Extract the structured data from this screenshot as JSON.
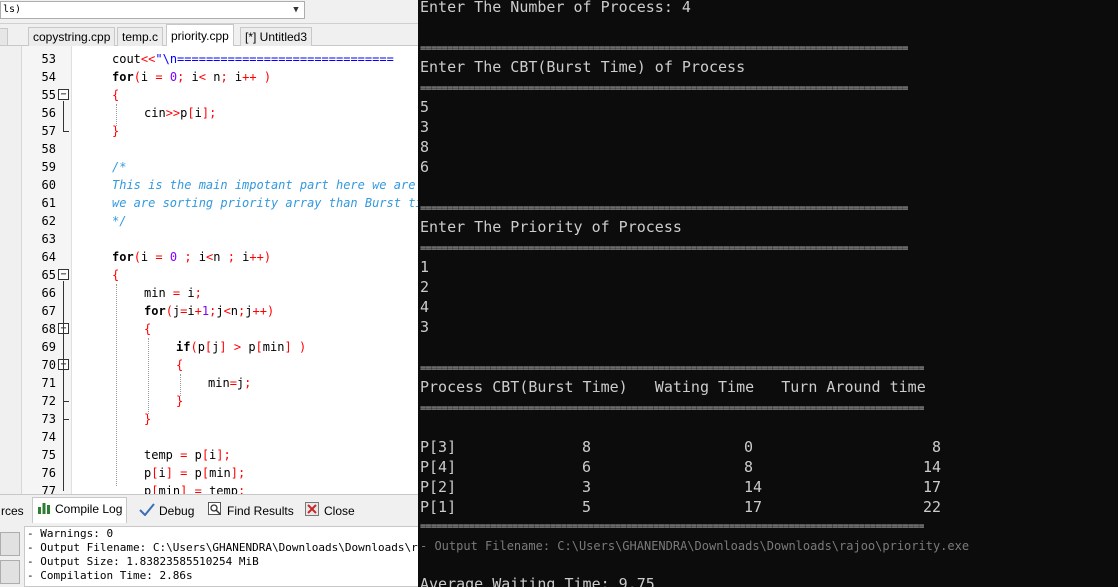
{
  "ide": {
    "scope_combo": "ls)",
    "tabs": [
      "copystring.cpp",
      "temp.c",
      "priority.cpp",
      "[*] Untitled3"
    ],
    "code_lines": [
      {
        "num": "53",
        "text": "cout<<\"\\n=============================="
      },
      {
        "num": "54",
        "text": "for(i = 0; i< n; i++ )"
      },
      {
        "num": "55",
        "text": "{"
      },
      {
        "num": "56",
        "text": "cin>>p[i];"
      },
      {
        "num": "57",
        "text": "}"
      },
      {
        "num": "58",
        "text": ""
      },
      {
        "num": "59",
        "text": "/*"
      },
      {
        "num": "60",
        "text": "This is the main impotant part here we are sorting on order according to priority given and if"
      },
      {
        "num": "61",
        "text": "we are sorting priority array than Burst time array will also sort"
      },
      {
        "num": "62",
        "text": "*/"
      },
      {
        "num": "63",
        "text": ""
      },
      {
        "num": "64",
        "text": "for(i = 0 ; i<n ; i++)"
      },
      {
        "num": "65",
        "text": "{"
      },
      {
        "num": "66",
        "text": "min = i;"
      },
      {
        "num": "67",
        "text": "for(j=i+1;j<n;j++)"
      },
      {
        "num": "68",
        "text": "{"
      },
      {
        "num": "69",
        "text": "if(p[j] > p[min] )"
      },
      {
        "num": "70",
        "text": "{"
      },
      {
        "num": "71",
        "text": "min=j;"
      },
      {
        "num": "72",
        "text": "}"
      },
      {
        "num": "73",
        "text": "}"
      },
      {
        "num": "74",
        "text": ""
      },
      {
        "num": "75",
        "text": "temp = p[i];"
      },
      {
        "num": "76",
        "text": "p[i] = p[min];"
      },
      {
        "num": "77",
        "text": "p[min] = temp;"
      }
    ],
    "bottom_tabs": [
      "rces",
      "Compile Log",
      "Debug",
      "Find Results",
      "Close"
    ],
    "compile_log": [
      "- Warnings: 0",
      "- Output Filename: C:\\Users\\GHANENDRA\\Downloads\\Downloads\\rajoo\\priority.exe",
      "- Output Size: 1.83823585510254 MiB",
      "- Compilation Time: 2.86s"
    ]
  },
  "console": {
    "prompt_count": "Enter The Number of Process: 4",
    "prompt_cbt": "Enter The CBT(Burst Time) of Process",
    "cbt_inputs": [
      "5",
      "3",
      "8",
      "6"
    ],
    "prompt_priority": "Enter The Priority of Process",
    "priority_inputs": [
      "1",
      "2",
      "4",
      "3"
    ],
    "table_header": "Process CBT(Burst Time)   Wating Time   Turn Around time",
    "rows": [
      {
        "process": "P[3]",
        "cbt": "8",
        "waiting": "0",
        "turnaround": "8"
      },
      {
        "process": "P[4]",
        "cbt": "6",
        "waiting": "8",
        "turnaround": "14"
      },
      {
        "process": "P[2]",
        "cbt": "3",
        "waiting": "14",
        "turnaround": "17"
      },
      {
        "process": "P[1]",
        "cbt": "5",
        "waiting": "17",
        "turnaround": "22"
      }
    ],
    "avg_waiting": "Average Waiting Time: 9.75"
  },
  "colors": {
    "keyword": "#000000",
    "operator": "#ff0000",
    "number": "#8000ff",
    "comment": "#3399dd",
    "console_bg": "#0c0c0c",
    "console_text": "#cccccc"
  }
}
